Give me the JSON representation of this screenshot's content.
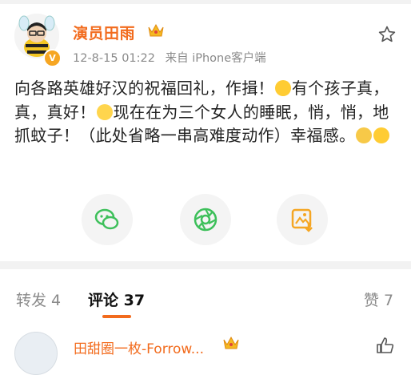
{
  "post": {
    "author": "演员田雨",
    "time": "12-8-15 01:22",
    "source": "来自 iPhone客户端",
    "text_part1": "向各路英雄好汉的祝福回礼，作揖！",
    "text_part2": "有个孩子真，真，真好！",
    "text_part3": "现在在为三个女人的睡眠，悄，悄，地抓蚊子！（此处省略一串高难度动作）幸福感。",
    "verified_icon": "v-badge-icon",
    "colors": {
      "accent": "#f26b1d",
      "muted": "#8a8a8a"
    }
  },
  "share": [
    "wechat-icon",
    "moments-icon",
    "save-image-icon"
  ],
  "tabs": {
    "repost": "转发 4",
    "comment": "评论 37",
    "like": "赞 7"
  },
  "comment": {
    "name": "田甜圈一枚-Forrow..."
  }
}
